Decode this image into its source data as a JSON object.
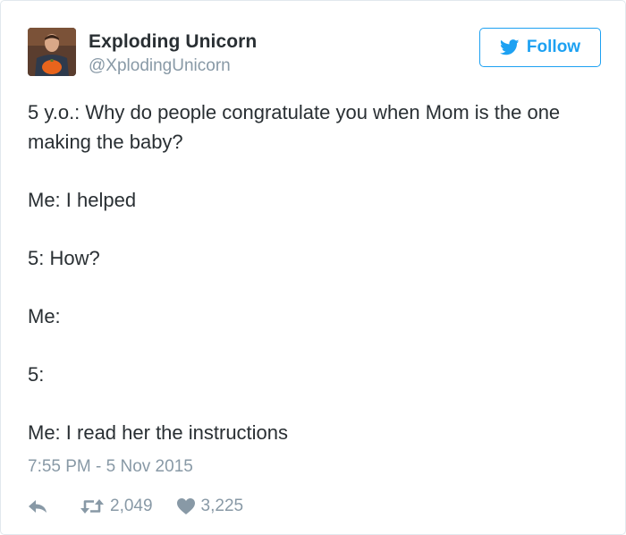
{
  "author": {
    "display_name": "Exploding Unicorn",
    "handle": "@XplodingUnicorn"
  },
  "follow_button": {
    "label": "Follow",
    "icon": "twitter-bird-icon",
    "color": "#1da1f2"
  },
  "tweet": {
    "lines": [
      "5 y.o.: Why do people congratulate you when Mom is the one making the baby?",
      "Me: I helped",
      "5: How?",
      "Me:",
      "5:",
      "Me: I read her the instructions"
    ],
    "timestamp": "7:55 PM - 5 Nov 2015"
  },
  "actions": {
    "reply_icon": "reply-arrow-icon",
    "retweet_icon": "retweet-icon",
    "retweet_count": "2,049",
    "like_icon": "heart-icon",
    "like_count": "3,225"
  },
  "colors": {
    "text": "#292f33",
    "muted": "#8899a6",
    "border": "#e1e8ed"
  }
}
